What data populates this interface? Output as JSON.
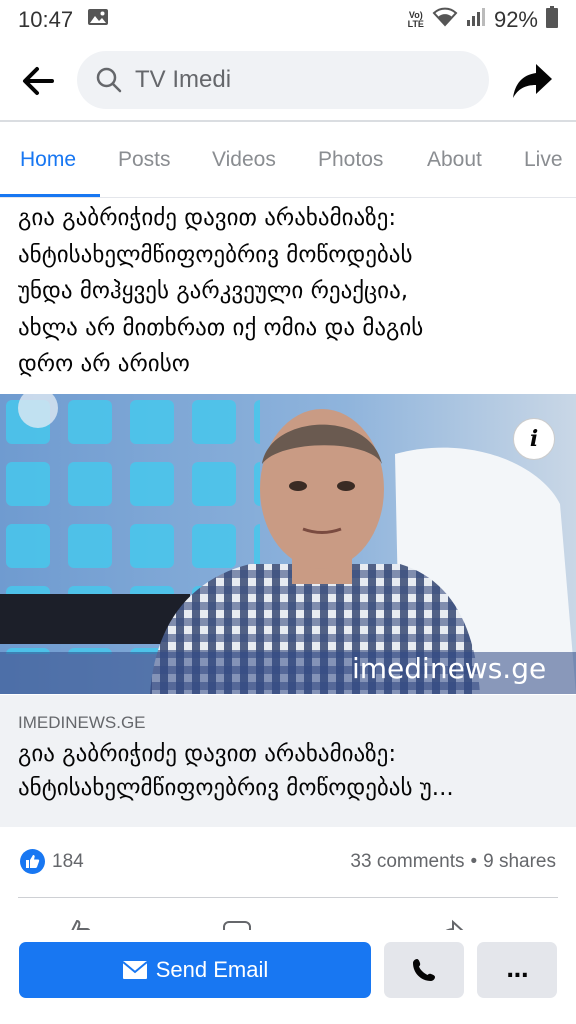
{
  "status_bar": {
    "time": "10:47",
    "network": "Vo) LTE",
    "battery": "92%"
  },
  "search": {
    "query": "TV Imedi"
  },
  "tabs": [
    {
      "label": "Home",
      "active": true
    },
    {
      "label": "Posts"
    },
    {
      "label": "Videos"
    },
    {
      "label": "Photos"
    },
    {
      "label": "About"
    },
    {
      "label": "Live"
    }
  ],
  "post": {
    "text_lines": [
      "გია გაბრიჭიძე დავით არახამიაზე:",
      "ანტისახელმწიფოებრივ მოწოდებას",
      "უნდა მოჰყვეს გარკვეული რეაქცია,",
      "ახლა არ მითხრათ იქ ომია და მაგის",
      "დრო არ არისო"
    ],
    "image": {
      "watermark": "imedinews.ge",
      "info_label": "i"
    },
    "link": {
      "domain": "IMEDINEWS.GE",
      "title_lines": [
        "გია გაბრიჭიძე დავით არახამიაზე:",
        "ანტისახელმწიფოებრივ მოწოდებას უ..."
      ]
    },
    "reactions": {
      "likes": "184",
      "comments": "33 comments",
      "separator": "•",
      "shares": "9 shares"
    }
  },
  "bottom_bar": {
    "send_email": "Send Email",
    "more": "..."
  },
  "colors": {
    "accent": "#1877f2",
    "muted": "#65676b",
    "button_gray": "#e4e6eb",
    "preview_bg": "#f0f2f5"
  }
}
